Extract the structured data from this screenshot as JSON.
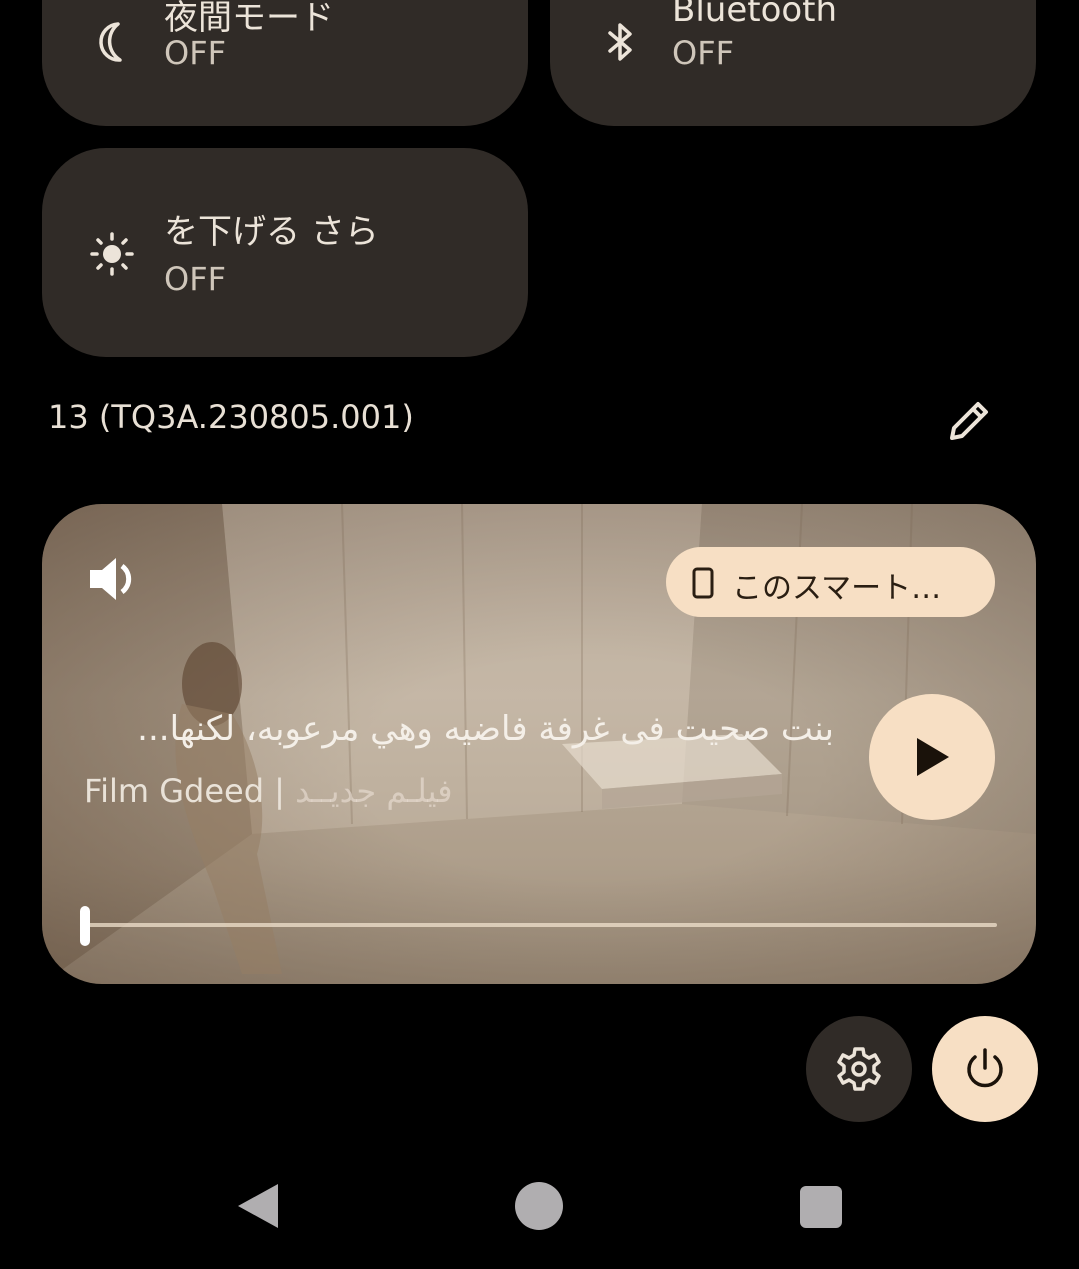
{
  "quick_settings": {
    "tiles": [
      {
        "label": "夜間モード",
        "state": "OFF",
        "icon": "moon-icon"
      },
      {
        "label": "Bluetooth",
        "state": "OFF",
        "icon": "bluetooth-icon"
      },
      {
        "label": "を下げる          さら",
        "state": "OFF",
        "icon": "brightness-icon"
      }
    ],
    "build_number": "13 (TQ3A.230805.001)"
  },
  "media": {
    "title": "بنت صحيت فى غرفة فاضيه وهي مرعوبه، لكنها...",
    "artist_latin": "Film Gdeed | ",
    "artist_arabic": "فيلـم جديــد",
    "output_chip": "このスマート…",
    "progress": 0.0,
    "icons": [
      "volume-icon",
      "phone-icon",
      "play-icon"
    ]
  },
  "footer": {
    "icons": [
      "settings-icon",
      "power-icon"
    ]
  },
  "navbar": {
    "icons": [
      "back-icon",
      "home-icon",
      "recents-icon"
    ]
  },
  "colors": {
    "tile_bg": "#302b27",
    "accent": "#f7dfc4",
    "background": "#000000"
  }
}
